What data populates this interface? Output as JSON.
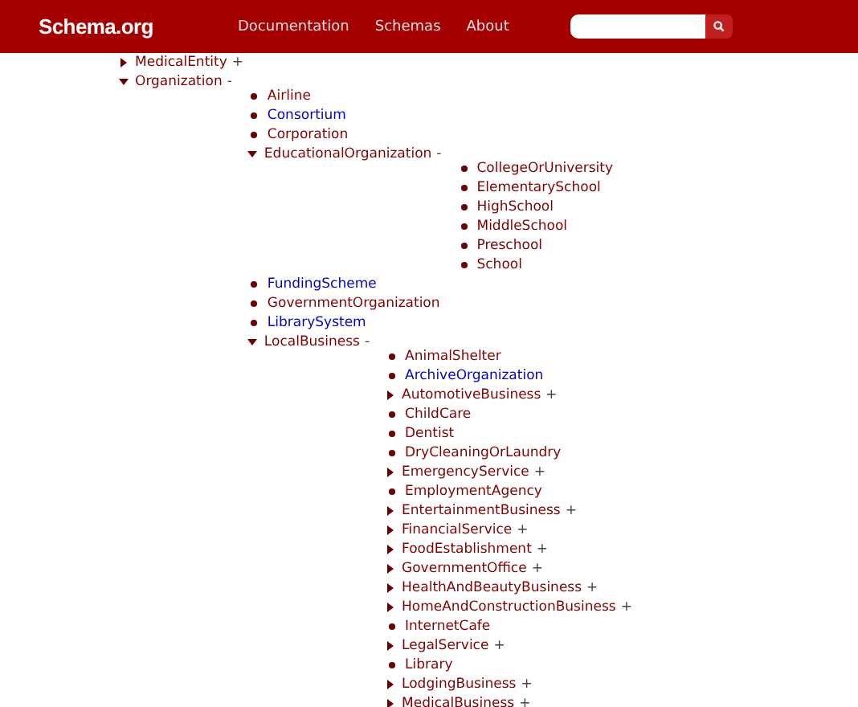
{
  "header": {
    "logo": "Schema.org",
    "nav": [
      "Documentation",
      "Schemas",
      "About"
    ]
  },
  "tree": [
    {
      "label": "MedicalEntity",
      "kind": "collapsed",
      "sign": "+",
      "color": "#800000"
    },
    {
      "label": "Organization",
      "kind": "expanded",
      "sign": "-",
      "color": "#800000",
      "children": [
        {
          "label": "Airline",
          "kind": "leaf",
          "color": "#800000"
        },
        {
          "label": "Consortium",
          "kind": "leaf",
          "color": "#0000cc"
        },
        {
          "label": "Corporation",
          "kind": "leaf",
          "color": "#800000"
        },
        {
          "label": "EducationalOrganization",
          "kind": "expanded",
          "sign": "-",
          "color": "#800000",
          "children": [
            {
              "label": "CollegeOrUniversity",
              "kind": "leaf",
              "color": "#800000"
            },
            {
              "label": "ElementarySchool",
              "kind": "leaf",
              "color": "#800000"
            },
            {
              "label": "HighSchool",
              "kind": "leaf",
              "color": "#800000"
            },
            {
              "label": "MiddleSchool",
              "kind": "leaf",
              "color": "#800000"
            },
            {
              "label": "Preschool",
              "kind": "leaf",
              "color": "#800000"
            },
            {
              "label": "School",
              "kind": "leaf",
              "color": "#800000"
            }
          ]
        },
        {
          "label": "FundingScheme",
          "kind": "leaf",
          "color": "#0000cc"
        },
        {
          "label": "GovernmentOrganization",
          "kind": "leaf",
          "color": "#800000"
        },
        {
          "label": "LibrarySystem",
          "kind": "leaf",
          "color": "#0000cc"
        },
        {
          "label": "LocalBusiness",
          "kind": "expanded",
          "sign": "-",
          "color": "#800000",
          "children": [
            {
              "label": "AnimalShelter",
              "kind": "leaf",
              "color": "#800000"
            },
            {
              "label": "ArchiveOrganization",
              "kind": "leaf",
              "color": "#0000cc"
            },
            {
              "label": "AutomotiveBusiness",
              "kind": "collapsed",
              "sign": "+",
              "color": "#800000"
            },
            {
              "label": "ChildCare",
              "kind": "leaf",
              "color": "#800000"
            },
            {
              "label": "Dentist",
              "kind": "leaf",
              "color": "#800000"
            },
            {
              "label": "DryCleaningOrLaundry",
              "kind": "leaf",
              "color": "#800000"
            },
            {
              "label": "EmergencyService",
              "kind": "collapsed",
              "sign": "+",
              "color": "#800000"
            },
            {
              "label": "EmploymentAgency",
              "kind": "leaf",
              "color": "#800000"
            },
            {
              "label": "EntertainmentBusiness",
              "kind": "collapsed",
              "sign": "+",
              "color": "#800000"
            },
            {
              "label": "FinancialService",
              "kind": "collapsed",
              "sign": "+",
              "color": "#800000"
            },
            {
              "label": "FoodEstablishment",
              "kind": "collapsed",
              "sign": "+",
              "color": "#800000"
            },
            {
              "label": "GovernmentOffice",
              "kind": "collapsed",
              "sign": "+",
              "color": "#800000"
            },
            {
              "label": "HealthAndBeautyBusiness",
              "kind": "collapsed",
              "sign": "+",
              "color": "#800000"
            },
            {
              "label": "HomeAndConstructionBusiness",
              "kind": "collapsed",
              "sign": "+",
              "color": "#800000"
            },
            {
              "label": "InternetCafe",
              "kind": "leaf",
              "color": "#800000"
            },
            {
              "label": "LegalService",
              "kind": "collapsed",
              "sign": "+",
              "color": "#800000"
            },
            {
              "label": "Library",
              "kind": "leaf",
              "color": "#800000"
            },
            {
              "label": "LodgingBusiness",
              "kind": "collapsed",
              "sign": "+",
              "color": "#800000"
            },
            {
              "label": "MedicalBusiness",
              "kind": "collapsed",
              "sign": "+",
              "color": "#800000"
            }
          ]
        }
      ]
    }
  ]
}
